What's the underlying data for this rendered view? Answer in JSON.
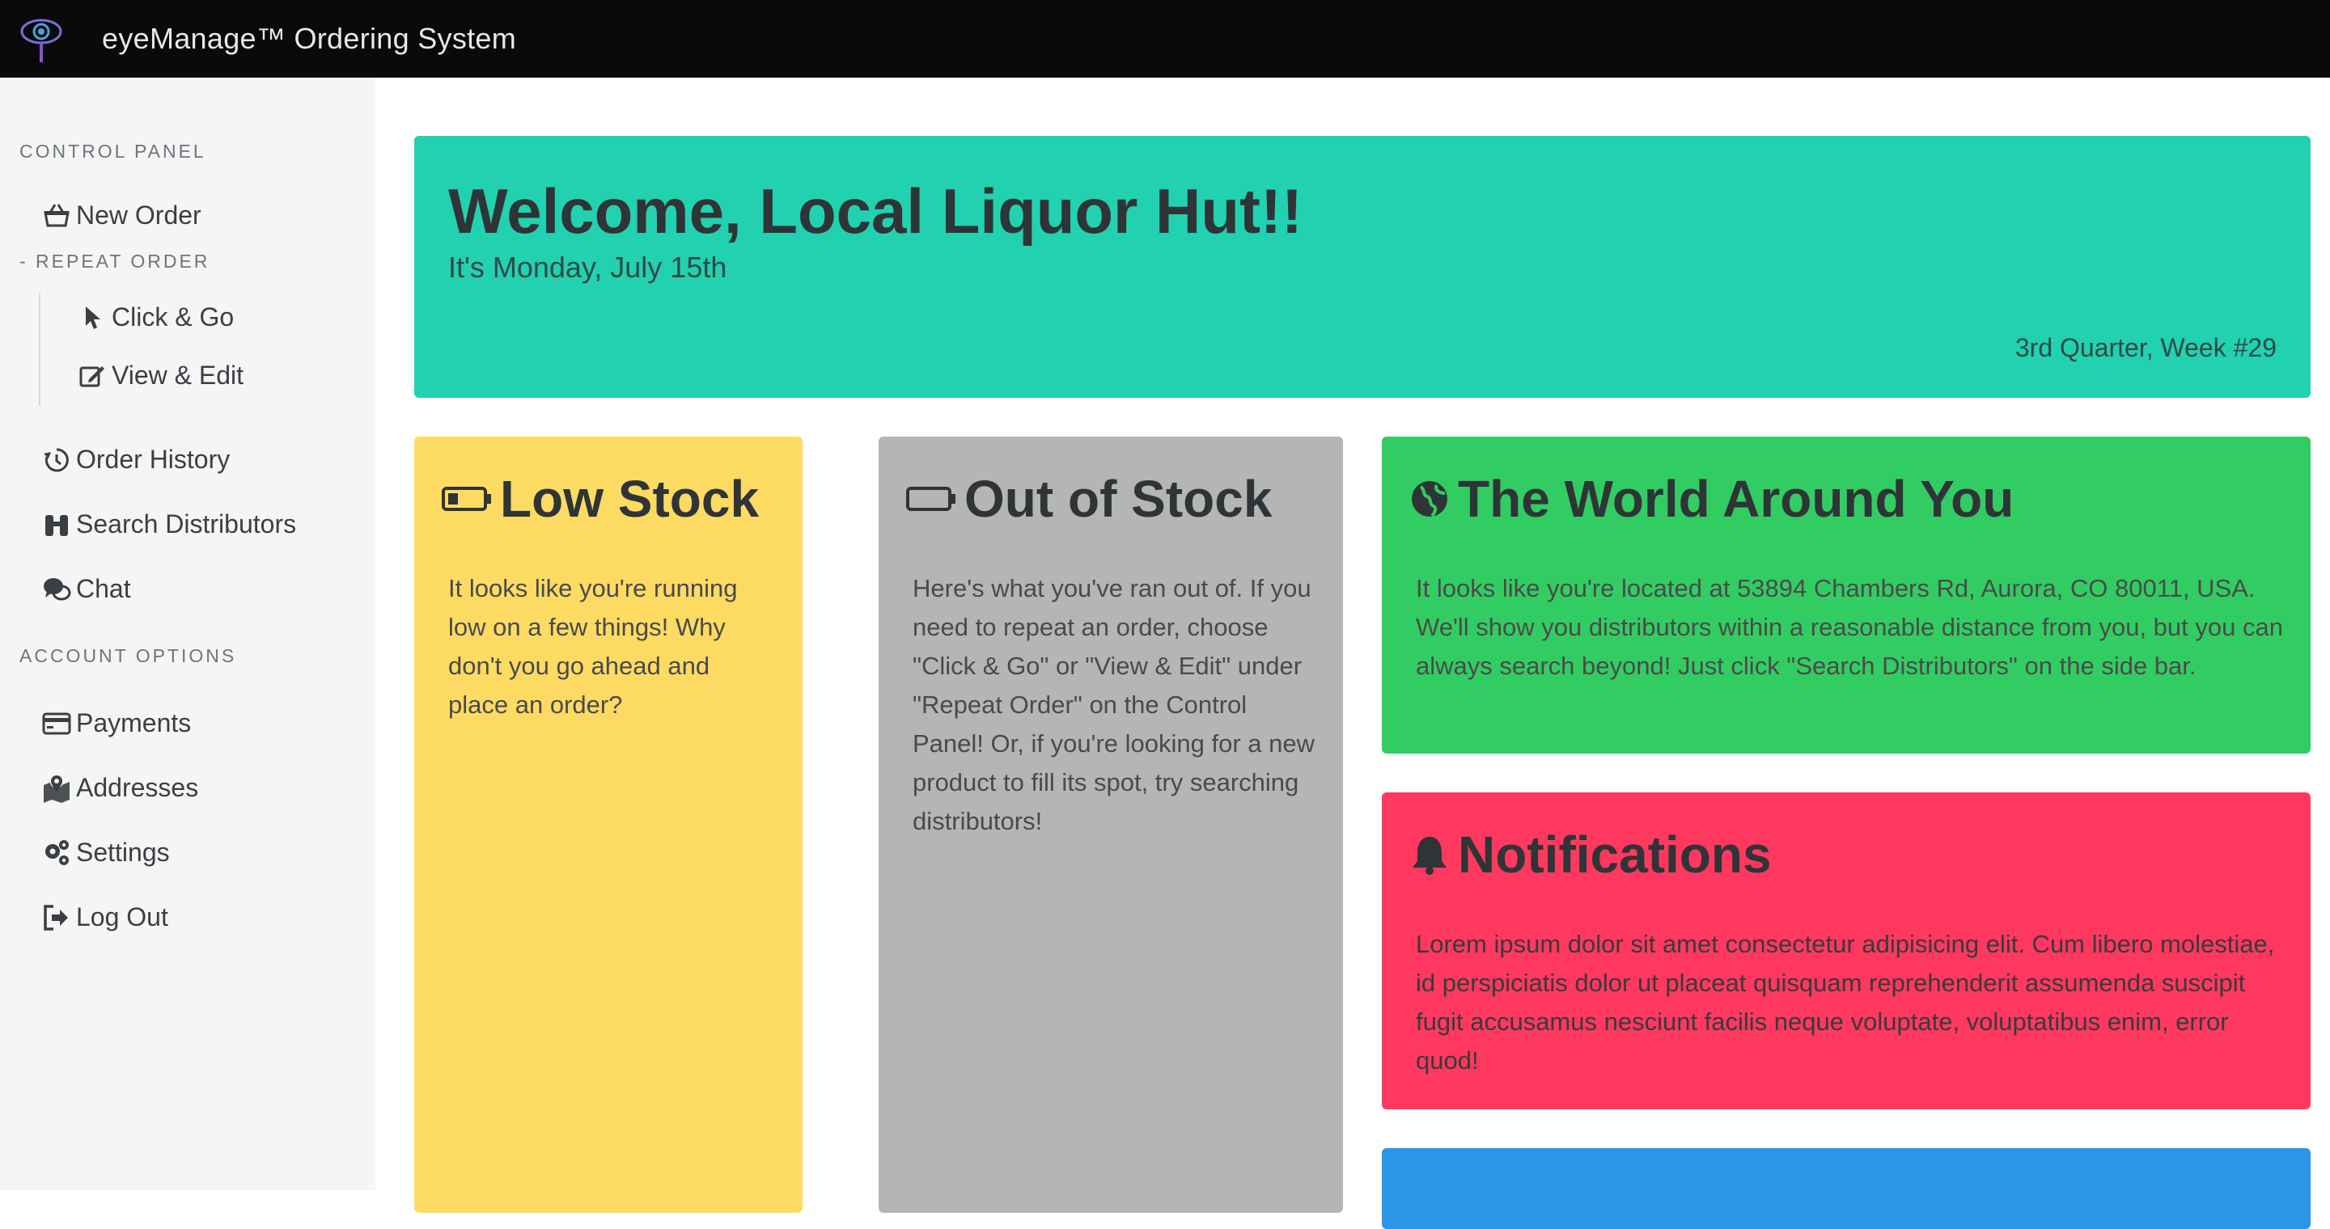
{
  "navbar": {
    "brand": "eyeManage™ Ordering System",
    "logo_icon": "eye-magnifier-logo"
  },
  "sidebar": {
    "control_panel_heading": "CONTROL PANEL",
    "repeat_order_heading": "- REPEAT ORDER",
    "account_options_heading": "ACCOUNT OPTIONS",
    "items": {
      "new_order": "New Order",
      "click_go": "Click & Go",
      "view_edit": "View & Edit",
      "order_history": "Order History",
      "search_distributors": "Search Distributors",
      "chat": "Chat",
      "payments": "Payments",
      "addresses": "Addresses",
      "settings": "Settings",
      "log_out": "Log Out"
    }
  },
  "welcome": {
    "title": "Welcome, Local Liquor Hut!!",
    "date": "It's Monday, July 15th",
    "quarter": "3rd Quarter, Week #29"
  },
  "cards": {
    "low_stock": {
      "title": "Low Stock",
      "text": "It looks like you're running low on a few things! Why don't you go ahead and place an order?"
    },
    "out_of_stock": {
      "title": "Out of Stock",
      "text": "Here's what you've ran out of. If you need to repeat an order, choose \"Click & Go\" or \"View & Edit\" under \"Repeat Order\" on the Control Panel! Or, if you're looking for a new product to fill its spot, try searching distributors!"
    },
    "world": {
      "title": "The World Around You",
      "text": "It looks like you're located at 53894 Chambers Rd, Aurora, CO 80011, USA. We'll show you distributors within a reasonable distance from you, but you can always search beyond! Just click \"Search Distributors\" on the side bar."
    },
    "notifications": {
      "title": "Notifications",
      "text": "Lorem ipsum dolor sit amet consectetur adipisicing elit. Cum libero molestiae, id perspiciatis dolor ut placeat quisquam reprehenderit assumenda suscipit fugit accusamus nesciunt facilis neque voluptate, voluptatibus enim, error quod!"
    }
  },
  "colors": {
    "navbar": "#0a0a0a",
    "welcome": "#22d1b0",
    "low_stock": "#fddb63",
    "out_of_stock": "#b5b5b5",
    "world": "#32cd62",
    "notifications": "#ff3860",
    "blue_card": "#2b95e8"
  }
}
